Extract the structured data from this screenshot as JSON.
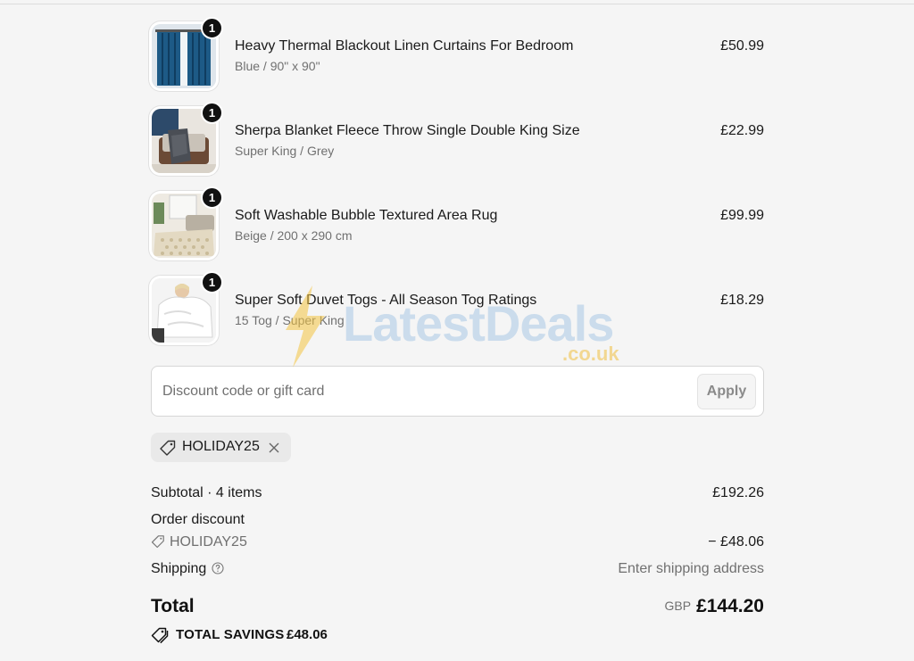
{
  "items": [
    {
      "title": "Heavy Thermal Blackout Linen Curtains For Bedroom",
      "variant": "Blue / 90\" x 90\"",
      "price": "£50.99",
      "quantity": "1",
      "image_icon": "curtains-image"
    },
    {
      "title": "Sherpa Blanket Fleece Throw Single Double King Size",
      "variant": "Super King / Grey",
      "price": "£22.99",
      "quantity": "1",
      "image_icon": "blanket-image"
    },
    {
      "title": "Soft Washable Bubble Textured Area Rug",
      "variant": "Beige / 200 x 290 cm",
      "price": "£99.99",
      "quantity": "1",
      "image_icon": "rug-image"
    },
    {
      "title": "Super Soft Duvet Togs - All Season Tog Ratings",
      "variant": "15 Tog / Super King",
      "price": "£18.29",
      "quantity": "1",
      "image_icon": "duvet-image"
    }
  ],
  "discount": {
    "placeholder": "Discount code or gift card",
    "apply_label": "Apply",
    "applied_code": "HOLIDAY25"
  },
  "summary": {
    "subtotal_label": "Subtotal · 4 items",
    "subtotal_value": "£192.26",
    "order_discount_label": "Order discount",
    "order_discount_code": "HOLIDAY25",
    "order_discount_value": "− £48.06",
    "shipping_label": "Shipping",
    "shipping_value": "Enter shipping address",
    "total_label": "Total",
    "currency": "GBP",
    "total_value": "£144.20",
    "savings_label": "TOTAL SAVINGS",
    "savings_value": "£48.06"
  },
  "watermark": {
    "text": "LatestDeals",
    "sub": ".co.uk"
  },
  "colors": {
    "background": "#f5f5f5",
    "text": "#1a1a1a",
    "muted": "#707070",
    "badge": "#111111",
    "watermark_blue": "#a9c9e6",
    "watermark_yellow": "#f0c040"
  }
}
